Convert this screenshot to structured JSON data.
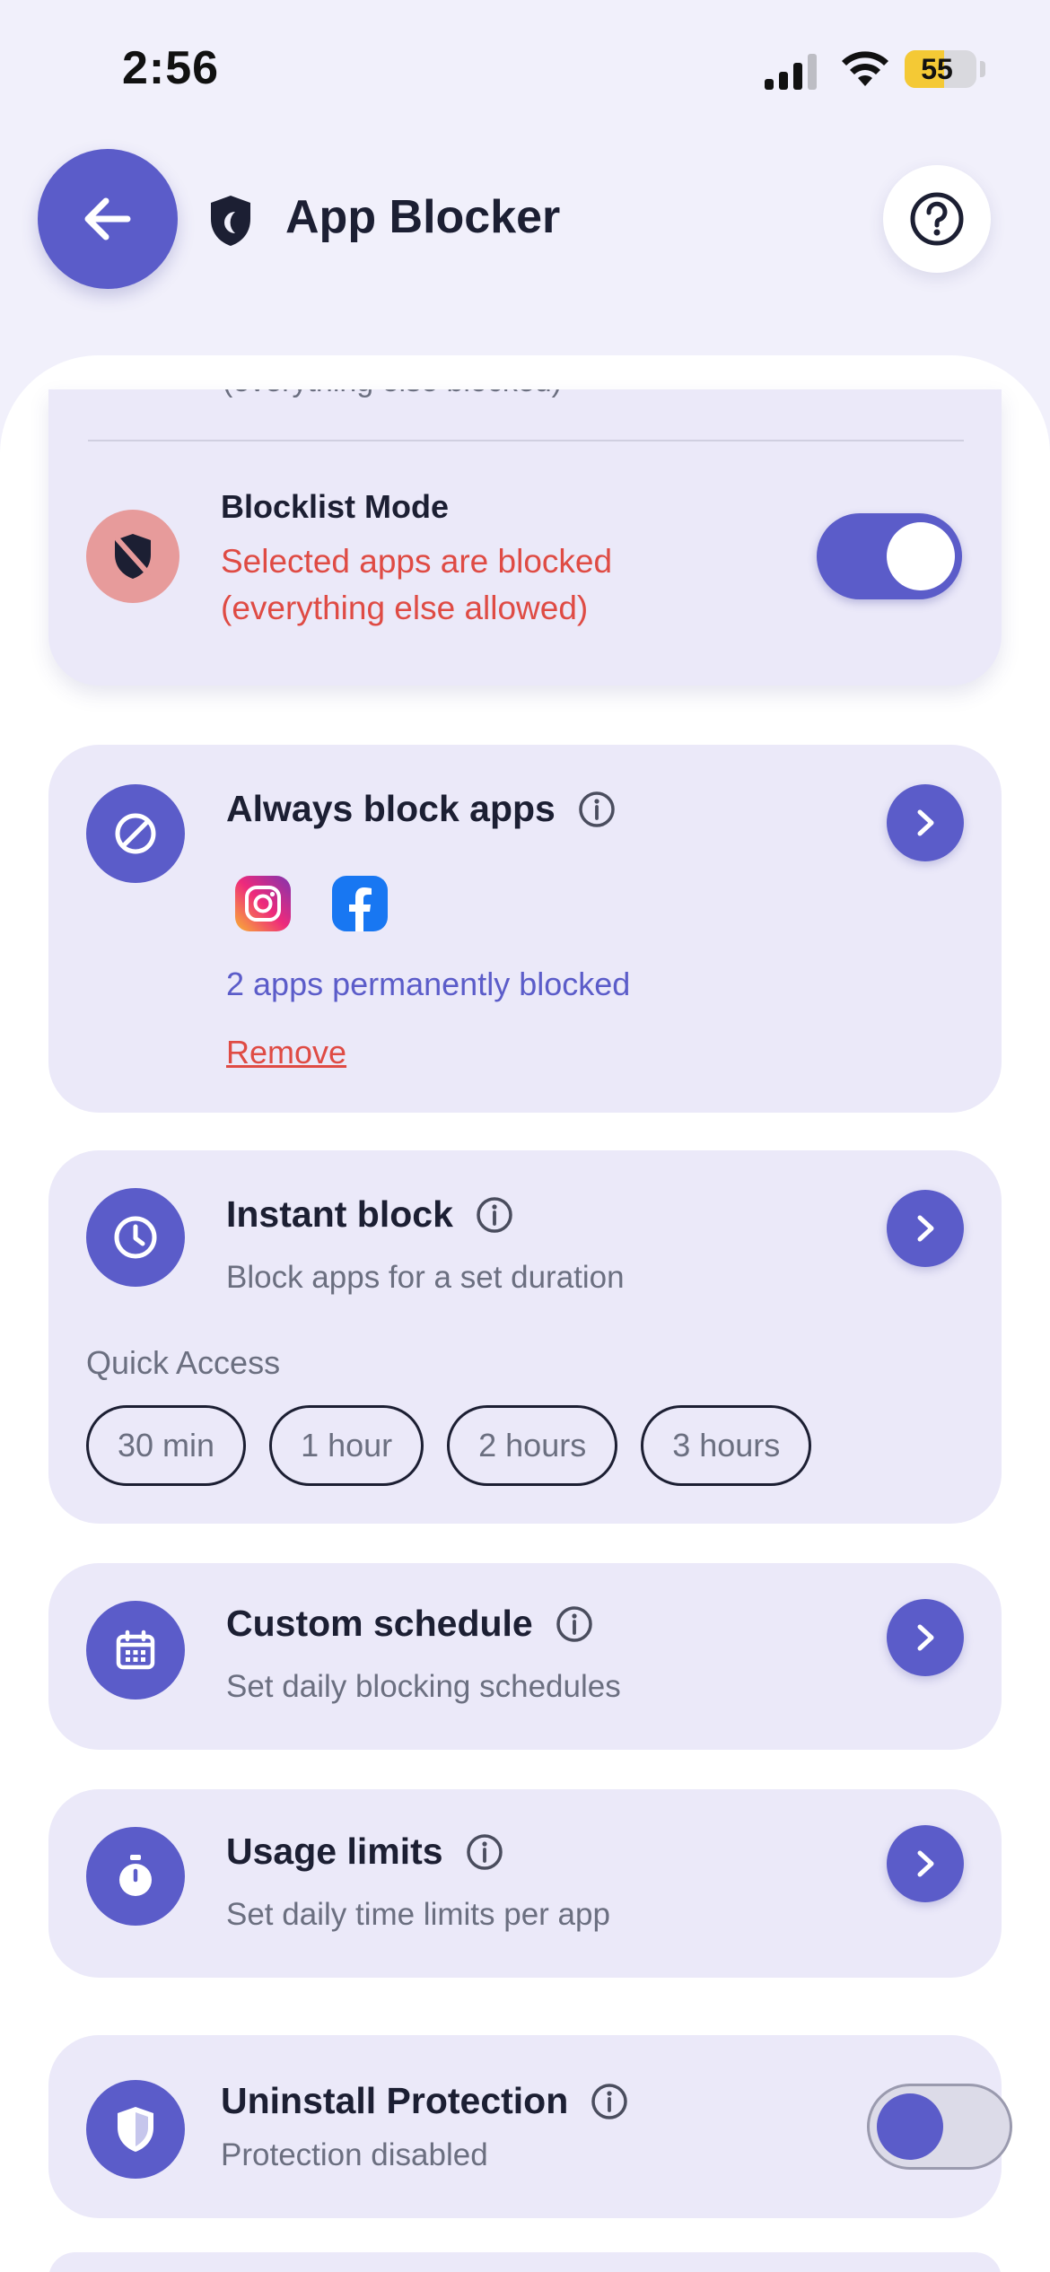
{
  "status": {
    "time": "2:56",
    "battery": "55"
  },
  "header": {
    "title": "App Blocker"
  },
  "mode": {
    "clipped_text": "(everything else blocked)",
    "title": "Blocklist Mode",
    "desc_line1": "Selected apps are blocked",
    "desc_line2": "(everything else allowed)",
    "enabled": true
  },
  "always_block": {
    "title": "Always block apps",
    "apps": [
      "instagram-icon",
      "facebook-icon"
    ],
    "count_text": "2 apps permanently blocked",
    "remove_label": "Remove"
  },
  "instant_block": {
    "title": "Instant block",
    "subtitle": "Block apps for a set duration",
    "quick_access_label": "Quick Access",
    "chips": [
      "30 min",
      "1 hour",
      "2 hours",
      "3 hours"
    ]
  },
  "custom_schedule": {
    "title": "Custom schedule",
    "subtitle": "Set daily blocking schedules"
  },
  "usage_limits": {
    "title": "Usage limits",
    "subtitle": "Set daily time limits per app"
  },
  "uninstall_protection": {
    "title": "Uninstall Protection",
    "subtitle": "Protection disabled",
    "enabled": false
  },
  "colors": {
    "accent": "#5b5cc9",
    "danger": "#df4b44",
    "card": "#ebe9f9",
    "background": "#f1f0fb"
  }
}
